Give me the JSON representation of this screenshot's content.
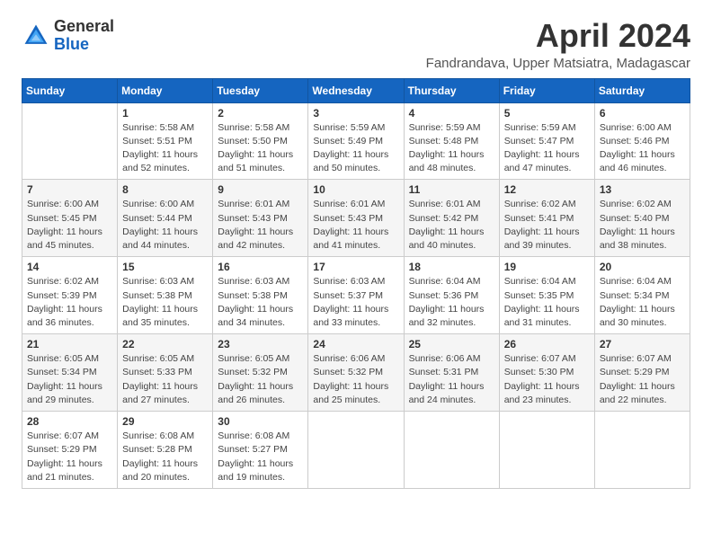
{
  "header": {
    "logo_general": "General",
    "logo_blue": "Blue",
    "month_title": "April 2024",
    "location": "Fandrandava, Upper Matsiatra, Madagascar"
  },
  "weekdays": [
    "Sunday",
    "Monday",
    "Tuesday",
    "Wednesday",
    "Thursday",
    "Friday",
    "Saturday"
  ],
  "weeks": [
    [
      {
        "day": "",
        "sunrise": "",
        "sunset": "",
        "daylight": ""
      },
      {
        "day": "1",
        "sunrise": "Sunrise: 5:58 AM",
        "sunset": "Sunset: 5:51 PM",
        "daylight": "Daylight: 11 hours and 52 minutes."
      },
      {
        "day": "2",
        "sunrise": "Sunrise: 5:58 AM",
        "sunset": "Sunset: 5:50 PM",
        "daylight": "Daylight: 11 hours and 51 minutes."
      },
      {
        "day": "3",
        "sunrise": "Sunrise: 5:59 AM",
        "sunset": "Sunset: 5:49 PM",
        "daylight": "Daylight: 11 hours and 50 minutes."
      },
      {
        "day": "4",
        "sunrise": "Sunrise: 5:59 AM",
        "sunset": "Sunset: 5:48 PM",
        "daylight": "Daylight: 11 hours and 48 minutes."
      },
      {
        "day": "5",
        "sunrise": "Sunrise: 5:59 AM",
        "sunset": "Sunset: 5:47 PM",
        "daylight": "Daylight: 11 hours and 47 minutes."
      },
      {
        "day": "6",
        "sunrise": "Sunrise: 6:00 AM",
        "sunset": "Sunset: 5:46 PM",
        "daylight": "Daylight: 11 hours and 46 minutes."
      }
    ],
    [
      {
        "day": "7",
        "sunrise": "Sunrise: 6:00 AM",
        "sunset": "Sunset: 5:45 PM",
        "daylight": "Daylight: 11 hours and 45 minutes."
      },
      {
        "day": "8",
        "sunrise": "Sunrise: 6:00 AM",
        "sunset": "Sunset: 5:44 PM",
        "daylight": "Daylight: 11 hours and 44 minutes."
      },
      {
        "day": "9",
        "sunrise": "Sunrise: 6:01 AM",
        "sunset": "Sunset: 5:43 PM",
        "daylight": "Daylight: 11 hours and 42 minutes."
      },
      {
        "day": "10",
        "sunrise": "Sunrise: 6:01 AM",
        "sunset": "Sunset: 5:43 PM",
        "daylight": "Daylight: 11 hours and 41 minutes."
      },
      {
        "day": "11",
        "sunrise": "Sunrise: 6:01 AM",
        "sunset": "Sunset: 5:42 PM",
        "daylight": "Daylight: 11 hours and 40 minutes."
      },
      {
        "day": "12",
        "sunrise": "Sunrise: 6:02 AM",
        "sunset": "Sunset: 5:41 PM",
        "daylight": "Daylight: 11 hours and 39 minutes."
      },
      {
        "day": "13",
        "sunrise": "Sunrise: 6:02 AM",
        "sunset": "Sunset: 5:40 PM",
        "daylight": "Daylight: 11 hours and 38 minutes."
      }
    ],
    [
      {
        "day": "14",
        "sunrise": "Sunrise: 6:02 AM",
        "sunset": "Sunset: 5:39 PM",
        "daylight": "Daylight: 11 hours and 36 minutes."
      },
      {
        "day": "15",
        "sunrise": "Sunrise: 6:03 AM",
        "sunset": "Sunset: 5:38 PM",
        "daylight": "Daylight: 11 hours and 35 minutes."
      },
      {
        "day": "16",
        "sunrise": "Sunrise: 6:03 AM",
        "sunset": "Sunset: 5:38 PM",
        "daylight": "Daylight: 11 hours and 34 minutes."
      },
      {
        "day": "17",
        "sunrise": "Sunrise: 6:03 AM",
        "sunset": "Sunset: 5:37 PM",
        "daylight": "Daylight: 11 hours and 33 minutes."
      },
      {
        "day": "18",
        "sunrise": "Sunrise: 6:04 AM",
        "sunset": "Sunset: 5:36 PM",
        "daylight": "Daylight: 11 hours and 32 minutes."
      },
      {
        "day": "19",
        "sunrise": "Sunrise: 6:04 AM",
        "sunset": "Sunset: 5:35 PM",
        "daylight": "Daylight: 11 hours and 31 minutes."
      },
      {
        "day": "20",
        "sunrise": "Sunrise: 6:04 AM",
        "sunset": "Sunset: 5:34 PM",
        "daylight": "Daylight: 11 hours and 30 minutes."
      }
    ],
    [
      {
        "day": "21",
        "sunrise": "Sunrise: 6:05 AM",
        "sunset": "Sunset: 5:34 PM",
        "daylight": "Daylight: 11 hours and 29 minutes."
      },
      {
        "day": "22",
        "sunrise": "Sunrise: 6:05 AM",
        "sunset": "Sunset: 5:33 PM",
        "daylight": "Daylight: 11 hours and 27 minutes."
      },
      {
        "day": "23",
        "sunrise": "Sunrise: 6:05 AM",
        "sunset": "Sunset: 5:32 PM",
        "daylight": "Daylight: 11 hours and 26 minutes."
      },
      {
        "day": "24",
        "sunrise": "Sunrise: 6:06 AM",
        "sunset": "Sunset: 5:32 PM",
        "daylight": "Daylight: 11 hours and 25 minutes."
      },
      {
        "day": "25",
        "sunrise": "Sunrise: 6:06 AM",
        "sunset": "Sunset: 5:31 PM",
        "daylight": "Daylight: 11 hours and 24 minutes."
      },
      {
        "day": "26",
        "sunrise": "Sunrise: 6:07 AM",
        "sunset": "Sunset: 5:30 PM",
        "daylight": "Daylight: 11 hours and 23 minutes."
      },
      {
        "day": "27",
        "sunrise": "Sunrise: 6:07 AM",
        "sunset": "Sunset: 5:29 PM",
        "daylight": "Daylight: 11 hours and 22 minutes."
      }
    ],
    [
      {
        "day": "28",
        "sunrise": "Sunrise: 6:07 AM",
        "sunset": "Sunset: 5:29 PM",
        "daylight": "Daylight: 11 hours and 21 minutes."
      },
      {
        "day": "29",
        "sunrise": "Sunrise: 6:08 AM",
        "sunset": "Sunset: 5:28 PM",
        "daylight": "Daylight: 11 hours and 20 minutes."
      },
      {
        "day": "30",
        "sunrise": "Sunrise: 6:08 AM",
        "sunset": "Sunset: 5:27 PM",
        "daylight": "Daylight: 11 hours and 19 minutes."
      },
      {
        "day": "",
        "sunrise": "",
        "sunset": "",
        "daylight": ""
      },
      {
        "day": "",
        "sunrise": "",
        "sunset": "",
        "daylight": ""
      },
      {
        "day": "",
        "sunrise": "",
        "sunset": "",
        "daylight": ""
      },
      {
        "day": "",
        "sunrise": "",
        "sunset": "",
        "daylight": ""
      }
    ]
  ]
}
